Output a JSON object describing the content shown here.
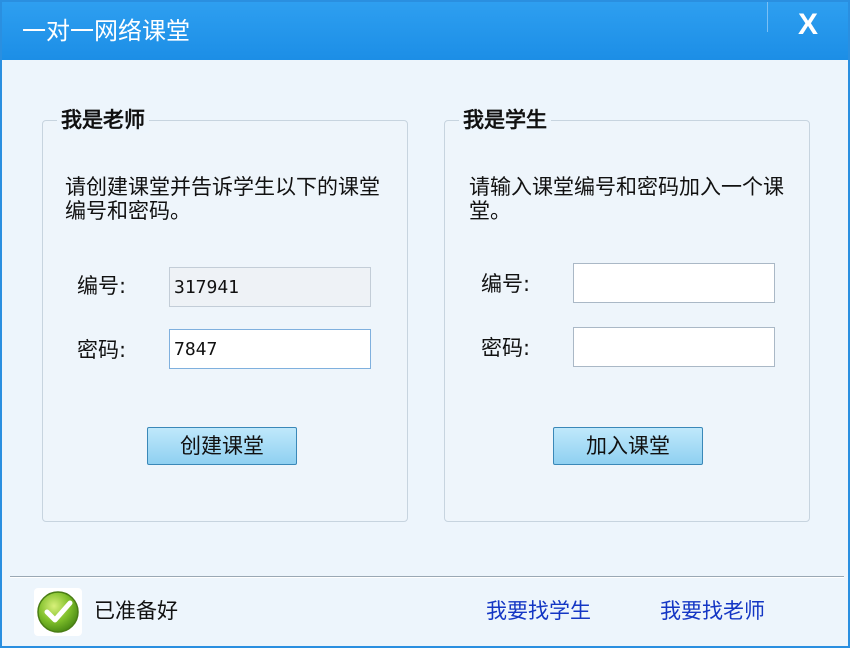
{
  "window": {
    "title": "一对一网络课堂",
    "close_label": "X"
  },
  "teacher": {
    "group_title": "我是老师",
    "description": "请创建课堂并告诉学生以下的课堂编号和密码。",
    "id_label": "编号:",
    "id_value": "317941",
    "password_label": "密码:",
    "password_value": "7847",
    "create_button": "创建课堂"
  },
  "student": {
    "group_title": "我是学生",
    "description": "请输入课堂编号和密码加入一个课堂。",
    "id_label": "编号:",
    "id_value": "",
    "password_label": "密码:",
    "password_value": "",
    "join_button": "加入课堂"
  },
  "footer": {
    "status_icon": "check-icon",
    "status_text": "已准备好",
    "link_find_student": "我要找学生",
    "link_find_teacher": "我要找老师"
  },
  "colors": {
    "titlebar": "#1c8ee6",
    "link": "#1436c4",
    "button": "#8fd0f1"
  }
}
